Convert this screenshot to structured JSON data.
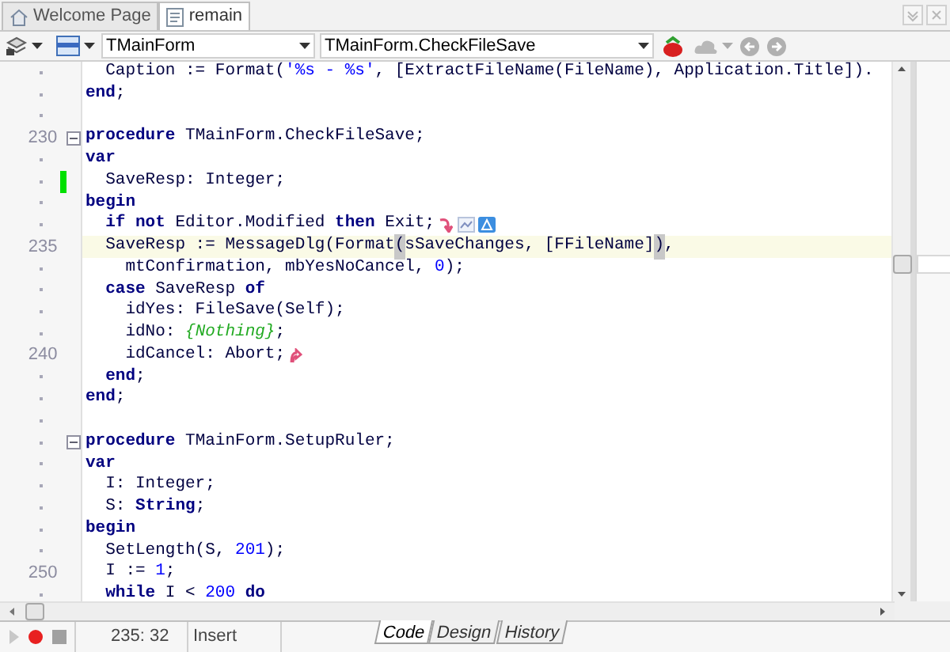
{
  "doc_tabs": [
    {
      "label": "Welcome Page",
      "kind": "home",
      "selected": false
    },
    {
      "label": "remain",
      "kind": "unit",
      "selected": true
    }
  ],
  "toolbar": {
    "class_combo": "TMainForm",
    "method_combo": "TMainForm.CheckFileSave"
  },
  "editor": {
    "lines": [
      {
        "modified": false,
        "current": false,
        "fold": false,
        "tokens": [
          {
            "kind": "text",
            "text": "  Caption := Format("
          },
          {
            "kind": "str",
            "text": "'%s - %s'"
          },
          {
            "kind": "text",
            "text": ", [ExtractFileName(FileName), Application.Title])."
          }
        ]
      },
      {
        "modified": false,
        "current": false,
        "fold": false,
        "tokens": [
          {
            "kind": "kw",
            "text": "end"
          },
          {
            "kind": "text",
            "text": ";"
          }
        ]
      },
      {
        "modified": false,
        "current": false,
        "fold": false
      },
      {
        "number": "230",
        "modified": false,
        "current": false,
        "fold": true,
        "tokens": [
          {
            "kind": "kw",
            "text": "procedure"
          },
          {
            "kind": "text",
            "text": " TMainForm.CheckFileSave;"
          }
        ]
      },
      {
        "modified": false,
        "current": false,
        "fold": false,
        "tokens": [
          {
            "kind": "kw",
            "text": "var"
          }
        ]
      },
      {
        "modified": true,
        "current": false,
        "fold": false,
        "tokens": [
          {
            "kind": "text",
            "text": "  SaveResp: Integer;"
          }
        ]
      },
      {
        "modified": false,
        "current": false,
        "fold": false,
        "tokens": [
          {
            "kind": "kw",
            "text": "begin"
          }
        ]
      },
      {
        "modified": false,
        "current": false,
        "fold": false,
        "tokens": [
          {
            "kind": "kw",
            "text": "  if not"
          },
          {
            "kind": "text",
            "text": " Editor.Modified "
          },
          {
            "kind": "kw",
            "text": "then"
          },
          {
            "kind": "text",
            "text": " Exit;"
          },
          {
            "kind": "exit_mark"
          },
          {
            "kind": "hint_marks"
          }
        ]
      },
      {
        "number": "235",
        "modified": false,
        "current": true,
        "fold": false,
        "tokens": [
          {
            "kind": "text",
            "text": "  SaveResp := MessageDlg(Format"
          },
          {
            "kind": "bracket",
            "text": "("
          },
          {
            "kind": "text",
            "text": "sSaveChanges, [FFileName]"
          },
          {
            "kind": "bracket",
            "text": ")"
          },
          {
            "kind": "text",
            "text": ","
          }
        ]
      },
      {
        "modified": false,
        "current": false,
        "fold": false,
        "tokens": [
          {
            "kind": "text",
            "text": "    mtConfirmation, mbYesNoCancel, "
          },
          {
            "kind": "num",
            "text": "0"
          },
          {
            "kind": "text",
            "text": ");"
          }
        ]
      },
      {
        "modified": false,
        "current": false,
        "fold": false,
        "tokens": [
          {
            "kind": "kw",
            "text": "  case"
          },
          {
            "kind": "text",
            "text": " SaveResp "
          },
          {
            "kind": "kw",
            "text": "of"
          }
        ]
      },
      {
        "modified": false,
        "current": false,
        "fold": false,
        "tokens": [
          {
            "kind": "text",
            "text": "    idYes: FileSave(Self);"
          }
        ]
      },
      {
        "modified": false,
        "current": false,
        "fold": false,
        "tokens": [
          {
            "kind": "text",
            "text": "    idNo: "
          },
          {
            "kind": "comment",
            "text": "{Nothing}"
          },
          {
            "kind": "text",
            "text": ";"
          }
        ]
      },
      {
        "number": "240",
        "modified": false,
        "current": false,
        "fold": false,
        "tokens": [
          {
            "kind": "text",
            "text": "    idCancel: Abort;"
          },
          {
            "kind": "return_mark"
          }
        ]
      },
      {
        "modified": false,
        "current": false,
        "fold": false,
        "tokens": [
          {
            "kind": "kw",
            "text": "  end"
          },
          {
            "kind": "text",
            "text": ";"
          }
        ]
      },
      {
        "modified": false,
        "current": false,
        "fold": false,
        "tokens": [
          {
            "kind": "kw",
            "text": "end"
          },
          {
            "kind": "text",
            "text": ";"
          }
        ]
      },
      {
        "modified": false,
        "current": false,
        "fold": false
      },
      {
        "modified": false,
        "current": false,
        "fold": true,
        "tokens": [
          {
            "kind": "kw",
            "text": "procedure"
          },
          {
            "kind": "text",
            "text": " TMainForm.SetupRuler;"
          }
        ]
      },
      {
        "modified": false,
        "current": false,
        "fold": false,
        "tokens": [
          {
            "kind": "kw",
            "text": "var"
          }
        ]
      },
      {
        "modified": false,
        "current": false,
        "fold": false,
        "tokens": [
          {
            "kind": "text",
            "text": "  I: Integer;"
          }
        ]
      },
      {
        "modified": false,
        "current": false,
        "fold": false,
        "tokens": [
          {
            "kind": "text",
            "text": "  S: "
          },
          {
            "kind": "kw",
            "text": "String"
          },
          {
            "kind": "text",
            "text": ";"
          }
        ]
      },
      {
        "modified": false,
        "current": false,
        "fold": false,
        "tokens": [
          {
            "kind": "kw",
            "text": "begin"
          }
        ]
      },
      {
        "modified": false,
        "current": false,
        "fold": false,
        "tokens": [
          {
            "kind": "text",
            "text": "  SetLength(S, "
          },
          {
            "kind": "num",
            "text": "201"
          },
          {
            "kind": "text",
            "text": ");"
          }
        ]
      },
      {
        "number": "250",
        "modified": false,
        "current": false,
        "fold": false,
        "tokens": [
          {
            "kind": "text",
            "text": "  I := "
          },
          {
            "kind": "num",
            "text": "1"
          },
          {
            "kind": "text",
            "text": ";"
          }
        ]
      },
      {
        "modified": false,
        "current": false,
        "fold": false,
        "tokens": [
          {
            "kind": "kw",
            "text": "  while"
          },
          {
            "kind": "text",
            "text": " I < "
          },
          {
            "kind": "num",
            "text": "200"
          },
          {
            "kind": "kw",
            "text": " do"
          }
        ]
      }
    ]
  },
  "status_bar": {
    "recording": true,
    "position": "235: 32",
    "mode": "Insert"
  },
  "view_tabs": [
    {
      "label": "Code",
      "selected": true
    },
    {
      "label": "Design",
      "selected": false
    },
    {
      "label": "History",
      "selected": false
    }
  ]
}
